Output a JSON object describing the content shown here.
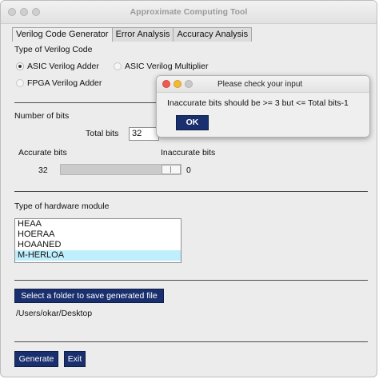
{
  "window": {
    "title": "Approximate Computing Tool"
  },
  "tabs": [
    "Verilog Code Generator",
    "Error Analysis",
    "Accuracy Analysis"
  ],
  "code_type": {
    "heading": "Type of Verilog Code",
    "options": [
      "ASIC Verilog Adder",
      "ASIC Verilog Multiplier",
      "FPGA Verilog Adder"
    ],
    "selected": "ASIC Verilog Adder"
  },
  "bits": {
    "heading": "Number of bits",
    "total_label": "Total bits",
    "total_value": "32",
    "accurate_label": "Accurate bits",
    "inaccurate_label": "Inaccurate bits",
    "accurate_value": "32",
    "inaccurate_value": "0",
    "slider_fraction": 1.0
  },
  "hardware": {
    "heading": "Type of hardware module",
    "items": [
      "HEAA",
      "HOERAA",
      "HOAANED",
      "M-HERLOA"
    ],
    "selected": "M-HERLOA"
  },
  "folder": {
    "button_label": "Select a folder to save generated file",
    "path": "/Users/okar/Desktop"
  },
  "actions": {
    "generate_label": "Generate",
    "exit_label": "Exit"
  },
  "dialog": {
    "title": "Please check your input",
    "message": "Inaccurate bits should be >= 3 but <= Total bits-1",
    "ok_label": "OK"
  },
  "colors": {
    "button_bg": "#1a2f6e",
    "selection": "#bfeefd",
    "dialog_close": "#ee5b53",
    "dialog_minimize": "#f2b936",
    "dialog_zoom": "#c9c9c9"
  }
}
